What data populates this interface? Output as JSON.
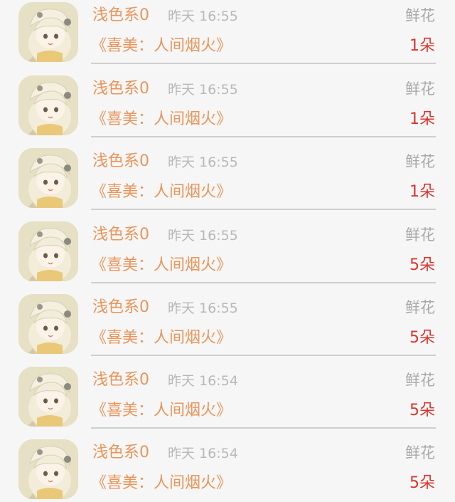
{
  "records": [
    {
      "user": "浅色系0",
      "time": "昨天 16:55",
      "gift": "鲜花",
      "book": "《喜美：人间烟火》",
      "amount": "1朵"
    },
    {
      "user": "浅色系0",
      "time": "昨天 16:55",
      "gift": "鲜花",
      "book": "《喜美：人间烟火》",
      "amount": "1朵"
    },
    {
      "user": "浅色系0",
      "time": "昨天 16:55",
      "gift": "鲜花",
      "book": "《喜美：人间烟火》",
      "amount": "1朵"
    },
    {
      "user": "浅色系0",
      "time": "昨天 16:55",
      "gift": "鲜花",
      "book": "《喜美：人间烟火》",
      "amount": "5朵"
    },
    {
      "user": "浅色系0",
      "time": "昨天 16:55",
      "gift": "鲜花",
      "book": "《喜美：人间烟火》",
      "amount": "5朵"
    },
    {
      "user": "浅色系0",
      "time": "昨天 16:54",
      "gift": "鲜花",
      "book": "《喜美：人间烟火》",
      "amount": "5朵"
    },
    {
      "user": "浅色系0",
      "time": "昨天 16:54",
      "gift": "鲜花",
      "book": "《喜美：人间烟火》",
      "amount": "5朵"
    }
  ],
  "colors": {
    "name": "#e8955a",
    "time": "#b8b8b8",
    "gift": "#a9a9a9",
    "amount": "#d9342d",
    "divider": "#cfcfcf",
    "background": "#f7f6f6"
  }
}
